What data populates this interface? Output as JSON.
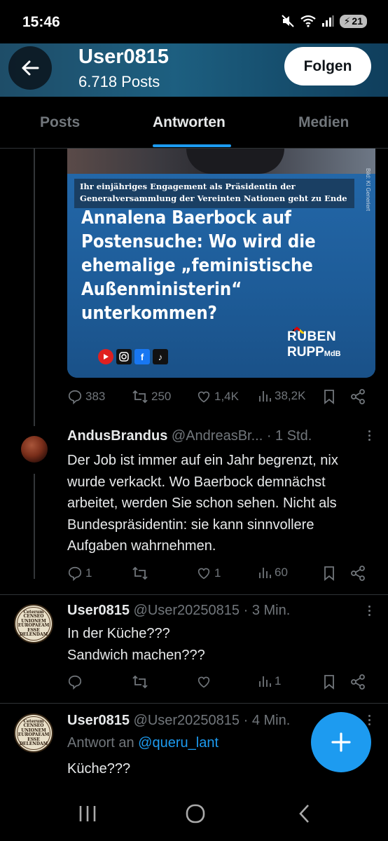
{
  "status_bar": {
    "time": "15:46",
    "battery": "21"
  },
  "header": {
    "name": "User0815",
    "post_count": "6.718 Posts",
    "follow_label": "Folgen"
  },
  "tabs": [
    {
      "label": "Posts",
      "active": false
    },
    {
      "label": "Antworten",
      "active": true
    },
    {
      "label": "Medien",
      "active": false
    }
  ],
  "media": {
    "banner_line1": "Ihr einjähriges Engagement als Präsidentin der",
    "banner_line2": "Generalversammlung der Vereinten Nationen geht zu Ende",
    "vertical_note": "Bild: KI Generiert",
    "headline": [
      "Annalena Baerbock auf",
      "Postensuche: Wo wird die",
      "ehemalige „feministische",
      "Außenministerin“",
      "unterkommen?"
    ],
    "logo_line1": "RUBEN",
    "logo_line2": "RUPP",
    "logo_suffix": "MdB"
  },
  "post0_actions": {
    "replies": "383",
    "reposts": "250",
    "likes": "1,4K",
    "views": "38,2K"
  },
  "posts": [
    {
      "name": "AndusBrandus",
      "handle_time": "@AndreasBr... · 1 Std.",
      "text": "Der Job ist immer auf ein Jahr begrenzt, nix wurde verkackt. Wo Baerbock demnächst arbeitet, werden Sie schon sehen. Nicht als Bundespräsidentin: sie kann sinnvollere Aufgaben wahrnehmen.",
      "replies": "1",
      "reposts": "",
      "likes": "1",
      "views": "60"
    },
    {
      "name": "User0815",
      "handle_time": "@User20250815 · 3 Min.",
      "text_line1": "In der Küche???",
      "text_line2": "Sandwich machen???",
      "replies": "",
      "reposts": "",
      "likes": "",
      "views": "1"
    },
    {
      "name": "User0815",
      "handle_time": "@User20250815 · 4 Min.",
      "reply_prefix": "Antwort an",
      "reply_mention": "@queru_lant",
      "text": "Küche???"
    }
  ],
  "seal_text": [
    "Ceterum",
    "CENSEO",
    "UNIONEM",
    "EUROPAEAM",
    "ESSE",
    "DELENDAM"
  ],
  "colors": {
    "accent": "#1d9bf0",
    "background": "#000000",
    "muted": "#71767b"
  }
}
